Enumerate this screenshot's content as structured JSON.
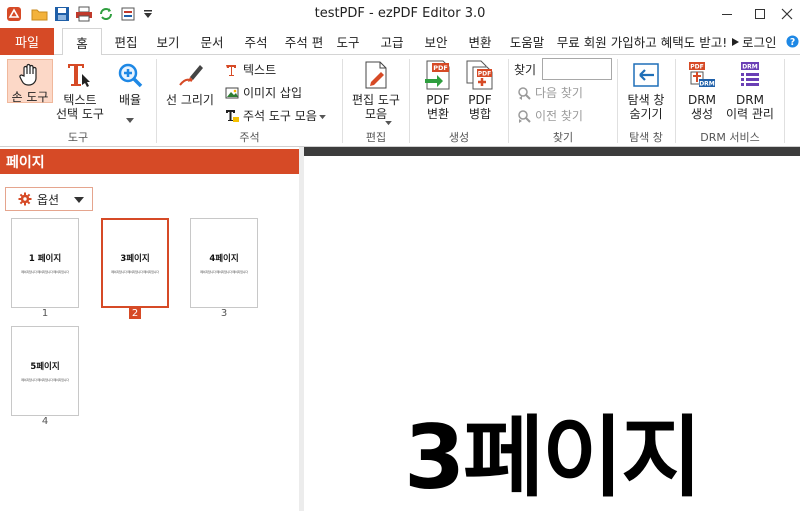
{
  "window": {
    "title": "testPDF - ezPDF Editor 3.0"
  },
  "quick_access": [
    "app-logo-icon",
    "open-folder-icon",
    "save-icon",
    "print-icon",
    "refresh-icon",
    "quick-menu-icon"
  ],
  "tabs": {
    "file": "파일",
    "items": [
      "홈",
      "편집",
      "보기",
      "문서",
      "주석",
      "주석 편",
      "도구",
      "고급",
      "보안",
      "변환",
      "도움말"
    ],
    "promo": "무료 회원 가입하고 혜택도 받고!",
    "login": "로그인"
  },
  "ribbon": {
    "tools": {
      "hand": "손 도구",
      "text_select": "텍스트\n선택 도구",
      "zoom": "배율",
      "group": "도구"
    },
    "annot": {
      "draw": "선 그리기",
      "text": "텍스트",
      "image": "이미지 삽입",
      "annot_tools": "주석 도구 모음",
      "group": "주석"
    },
    "edit": {
      "edit_tools": "편집 도구\n모음",
      "group": "편집"
    },
    "create": {
      "convert": "PDF\n변환",
      "merge": "PDF\n병합",
      "group": "생성"
    },
    "find": {
      "label": "찾기",
      "next": "다음 찾기",
      "prev": "이전 찾기",
      "group": "찾기",
      "query": ""
    },
    "nav": {
      "hide": "탐색 창\n숨기기",
      "group": "탐색 창"
    },
    "drm": {
      "create": "DRM\n생성",
      "history": "DRM\n이력 관리",
      "group": "DRM 서비스"
    }
  },
  "panel": {
    "title": "페이지",
    "options": "옵션",
    "thumbnails": [
      {
        "title": "1 페이지",
        "num": "1",
        "selected": false
      },
      {
        "title": "3페이지",
        "num": "2",
        "selected": true
      },
      {
        "title": "4페이지",
        "num": "3",
        "selected": false
      },
      {
        "title": "5페이지",
        "num": "4",
        "selected": false
      }
    ],
    "thumb_text": "페이지입니다 페이지입니다 페이지입니다"
  },
  "document": {
    "heading": "3페이지"
  },
  "colors": {
    "accent": "#d64a26",
    "selected_bg": "#fcd8c7",
    "workspace": "#3c3c3c"
  }
}
